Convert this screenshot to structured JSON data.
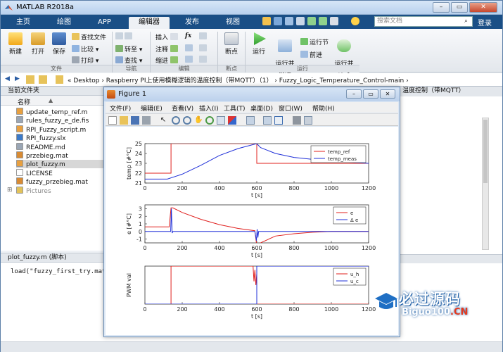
{
  "window": {
    "title": "MATLAB R2018a"
  },
  "tabs": [
    {
      "label": "主页"
    },
    {
      "label": "绘图"
    },
    {
      "label": "APP"
    },
    {
      "label": "编辑器",
      "active": true
    },
    {
      "label": "发布"
    },
    {
      "label": "视图"
    }
  ],
  "search": {
    "placeholder": "搜索文档"
  },
  "login": "登录",
  "ribbon": {
    "file": {
      "new": "新建",
      "open": "打开",
      "save": "保存",
      "find_files": "查找文件",
      "compare": "比较",
      "print": "打印",
      "group": "文件"
    },
    "nav": {
      "goto": "转至",
      "find": "查找",
      "group": "导航"
    },
    "edit": {
      "insert": "插入",
      "comment": "注释",
      "indent": "缩进",
      "fx": "fx",
      "group": "编辑"
    },
    "breakpoints": {
      "label": "断点",
      "group": "断点"
    },
    "run": {
      "run": "运行",
      "run_advance": "运行并\n前进",
      "run_section": "运行节",
      "advance": "前进",
      "run_time": "运行并\n计时",
      "group": "运行"
    }
  },
  "address": {
    "path": "« Desktop › Raspberry PI上使用模糊逻辑的温度控制（带MQTT）（1） › Fuzzy_Logic_Temperature_Control-main ›"
  },
  "left_panel": {
    "header": "当前文件夹",
    "column": "名称",
    "sort_arrow": "▲",
    "files": [
      {
        "name": "update_temp_ref.m",
        "color": "#e8a040"
      },
      {
        "name": "rules_fuzzy_e_de.fis",
        "color": "#9aa6b5"
      },
      {
        "name": "RPI_Fuzzy_script.m",
        "color": "#e8a040"
      },
      {
        "name": "RPI_fuzzy.slx",
        "color": "#3c7ac9"
      },
      {
        "name": "README.md",
        "color": "#9aa6b5"
      },
      {
        "name": "przebieg.mat",
        "color": "#d88b34"
      },
      {
        "name": "plot_fuzzy.m",
        "color": "#e8a040",
        "selected": true
      },
      {
        "name": "LICENSE",
        "color": "#ffffff"
      },
      {
        "name": "fuzzy_przebieg.mat",
        "color": "#d88b34"
      },
      {
        "name": "Pictures",
        "color": "#e2c25a",
        "folder": true
      }
    ],
    "details_header": "plot_fuzzy.m (脚本)",
    "details_line": "load(\"fuzzy_first_try.mat\");"
  },
  "right_panel": {
    "header": "温度控制（带MQTT）"
  },
  "figure": {
    "title": "Figure 1",
    "menu": [
      "文件(F)",
      "编辑(E)",
      "查看(V)",
      "插入(I)",
      "工具(T)",
      "桌面(D)",
      "窗口(W)",
      "帮助(H)"
    ]
  },
  "chart_data": [
    {
      "type": "line",
      "ylabel": "temp [#°C]",
      "xlabel": "t [s]",
      "xlim": [
        0,
        1200
      ],
      "ylim": [
        21,
        25
      ],
      "xticks": [
        0,
        200,
        400,
        600,
        800,
        1000,
        1200
      ],
      "yticks": [
        21,
        22,
        23,
        24,
        25
      ],
      "legend_position": "top-right",
      "series": [
        {
          "name": "temp_ref",
          "color": "#e0201e",
          "x": [
            0,
            140,
            140,
            600,
            600,
            1200
          ],
          "y": [
            22,
            22,
            25,
            25,
            23,
            23
          ]
        },
        {
          "name": "temp_meas",
          "color": "#1f2fd8",
          "x": [
            0,
            120,
            200,
            300,
            400,
            500,
            580,
            600,
            620,
            700,
            800,
            900,
            1000,
            1100,
            1200
          ],
          "y": [
            21.4,
            21.4,
            21.9,
            22.8,
            23.8,
            24.5,
            24.9,
            25.0,
            24.6,
            24.0,
            23.6,
            23.4,
            23.2,
            23.1,
            23.0
          ]
        }
      ]
    },
    {
      "type": "line",
      "ylabel": "e [#°C]",
      "xlabel": "t [s]",
      "xlim": [
        0,
        1200
      ],
      "ylim": [
        -1.5,
        3.5
      ],
      "xticks": [
        0,
        200,
        400,
        600,
        800,
        1000,
        1200
      ],
      "yticks": [
        -1,
        0,
        1,
        2,
        3
      ],
      "legend_position": "top-right",
      "series": [
        {
          "name": "e",
          "color": "#e0201e",
          "x": [
            0,
            130,
            140,
            150,
            200,
            300,
            400,
            500,
            590,
            600,
            620,
            700,
            800,
            900,
            1000,
            1100,
            1200
          ],
          "y": [
            0.6,
            0.6,
            3.1,
            3.1,
            2.5,
            1.6,
            0.9,
            0.4,
            0.1,
            -1.9,
            -1.5,
            -0.6,
            -0.3,
            -0.1,
            0.0,
            0.0,
            0.0
          ]
        },
        {
          "name": "Δ e",
          "color": "#1f2fd8",
          "x": [
            0,
            138,
            142,
            146,
            150,
            300,
            590,
            598,
            602,
            606,
            610,
            1200
          ],
          "y": [
            0,
            0,
            3.0,
            -0.2,
            0,
            0,
            0,
            -1.2,
            0.3,
            -0.8,
            0,
            0
          ]
        }
      ]
    },
    {
      "type": "line",
      "ylabel": "PWM val",
      "xlabel": "t [s]",
      "xlim": [
        0,
        1200
      ],
      "ylim": [
        0,
        1
      ],
      "xticks": [
        0,
        200,
        400,
        600,
        800,
        1000,
        1200
      ],
      "yticks": [],
      "legend_position": "top-right",
      "series": [
        {
          "name": "u_h",
          "color": "#e0201e",
          "x": [
            0,
            140,
            140,
            580,
            585,
            590,
            595,
            600,
            600,
            1200
          ],
          "y": [
            0,
            0,
            1,
            1,
            0.6,
            0.9,
            0.5,
            0.8,
            0,
            0
          ]
        },
        {
          "name": "u_c",
          "color": "#1f2fd8",
          "x": [
            0,
            600,
            600,
            1200
          ],
          "y": [
            0,
            0,
            1,
            1
          ]
        }
      ]
    }
  ],
  "watermark": {
    "brand": "必过源码",
    "url_main": "Biguo100",
    "url_suffix": ".CN"
  }
}
